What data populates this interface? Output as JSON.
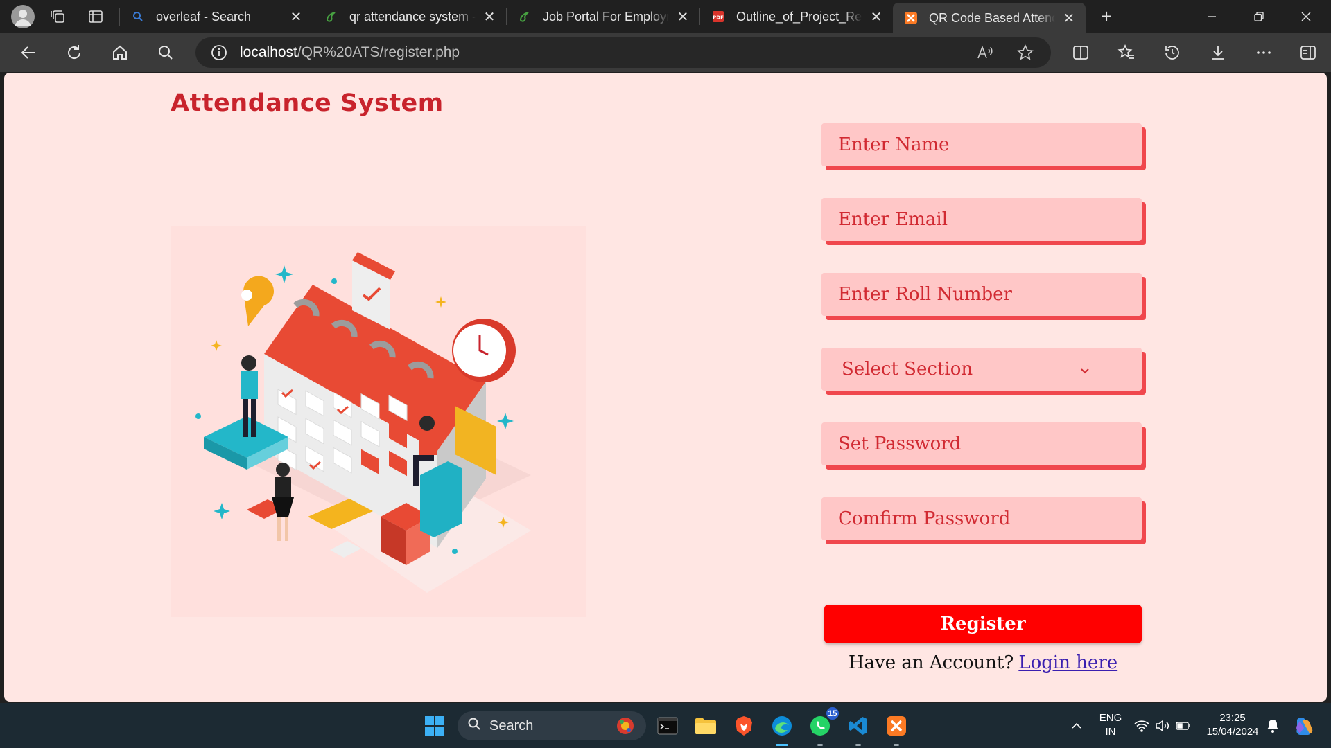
{
  "browser": {
    "tabs": [
      {
        "title": "overleaf - Search",
        "icon": "search-icon",
        "active": false
      },
      {
        "title": "qr attendance system - Overleaf",
        "icon": "overleaf-icon",
        "active": false
      },
      {
        "title": "Job Portal For Employment",
        "icon": "overleaf-icon",
        "active": false
      },
      {
        "title": "Outline_of_Project_Report",
        "icon": "pdf-icon",
        "active": false
      },
      {
        "title": "QR Code Based Attendance",
        "icon": "xampp-icon",
        "active": true
      }
    ],
    "address": {
      "host": "localhost",
      "path": "/QR%20ATS/register.php"
    }
  },
  "page": {
    "brand": "Attendance System",
    "form": {
      "name_placeholder": "Enter Name",
      "email_placeholder": "Enter Email",
      "roll_placeholder": "Enter Roll Number",
      "section_selected": "Select Section",
      "password_placeholder": "Set Password",
      "confirm_placeholder": "Comfirm Password",
      "register_label": "Register",
      "have_account": "Have an Account?",
      "login_link": "Login here"
    }
  },
  "taskbar": {
    "search_label": "Search",
    "whatsapp_badge": "15",
    "lang_top": "ENG",
    "lang_bottom": "IN",
    "time": "23:25",
    "date": "15/04/2024"
  },
  "colors": {
    "page_bg": "#ffe6e3",
    "field_bg": "#ffc7c7",
    "field_shadow": "#f0474d",
    "accent_text": "#d12a32",
    "register_bg": "#ff0000",
    "brand": "#c8232c"
  }
}
